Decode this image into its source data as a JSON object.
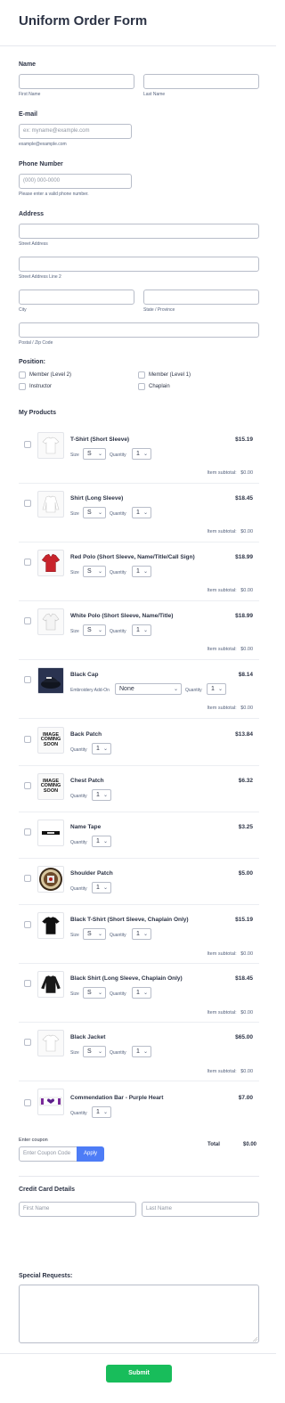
{
  "form": {
    "title": "Uniform Order Form"
  },
  "name": {
    "label": "Name",
    "first_sub": "First Name",
    "last_sub": "Last Name"
  },
  "email": {
    "label": "E-mail",
    "placeholder": "ex: myname@example.com",
    "sub": "example@example.com"
  },
  "phone": {
    "label": "Phone Number",
    "placeholder": "(000) 000-0000",
    "sub": "Please enter a valid phone number."
  },
  "address": {
    "label": "Address",
    "street": "Street Address",
    "street2": "Street Address Line 2",
    "city": "City",
    "state": "State / Province",
    "postal": "Postal / Zip Code"
  },
  "position": {
    "label": "Position:",
    "options": [
      "Member (Level 2)",
      "Member (Level 1)",
      "Instructor",
      "Chaplain"
    ]
  },
  "products": {
    "label": "My Products",
    "size_label": "Size",
    "qty_label": "Quantity",
    "embroidery_label": "Embroidery Add-On",
    "subtotal_label": "Item subtotal:",
    "subtotal_value": "$0.00",
    "coming_soon": [
      "IMAGE",
      "COMING",
      "SOON"
    ],
    "items": [
      {
        "name": "T-Shirt (Short Sleeve)",
        "price": "$15.19",
        "size": "S",
        "qty": "1"
      },
      {
        "name": "Shirt (Long Sleeve)",
        "price": "$18.45",
        "size": "S",
        "qty": "1"
      },
      {
        "name": "Red Polo (Short Sleeve, Name/Title/Call Sign)",
        "price": "$18.99",
        "size": "S",
        "qty": "1"
      },
      {
        "name": "White Polo (Short Sleeve, Name/Title)",
        "price": "$18.99",
        "size": "S",
        "qty": "1"
      },
      {
        "name": "Black Cap",
        "price": "$8.14",
        "embroidery": "None",
        "qty": "1"
      },
      {
        "name": "Back Patch",
        "price": "$13.84",
        "qty": "1"
      },
      {
        "name": "Chest Patch",
        "price": "$6.32",
        "qty": "1"
      },
      {
        "name": "Name Tape",
        "price": "$3.25",
        "qty": "1"
      },
      {
        "name": "Shoulder Patch",
        "price": "$5.00",
        "qty": "1"
      },
      {
        "name": "Black T-Shirt (Short Sleeve, Chaplain Only)",
        "price": "$15.19",
        "size": "S",
        "qty": "1"
      },
      {
        "name": "Black Shirt (Long Sleeve, Chaplain Only)",
        "price": "$18.45",
        "size": "S",
        "qty": "1"
      },
      {
        "name": "Black Jacket",
        "price": "$65.00",
        "size": "S",
        "qty": "1"
      },
      {
        "name": "Commendation Bar - Purple Heart",
        "price": "$7.00",
        "qty": "1"
      }
    ]
  },
  "coupon": {
    "label": "Enter coupon",
    "placeholder": "Enter Coupon Code",
    "apply": "Apply"
  },
  "total": {
    "label": "Total",
    "value": "$0.00"
  },
  "credit_card": {
    "label": "Credit Card Details",
    "first": "First Name",
    "last": "Last Name"
  },
  "special": {
    "label": "Special Requests:"
  },
  "submit": {
    "label": "Submit"
  },
  "colors": {
    "accent": "#4d7cf6",
    "submit": "#18bd5b",
    "text": "#2c3345",
    "border": "#b8bdc9"
  }
}
